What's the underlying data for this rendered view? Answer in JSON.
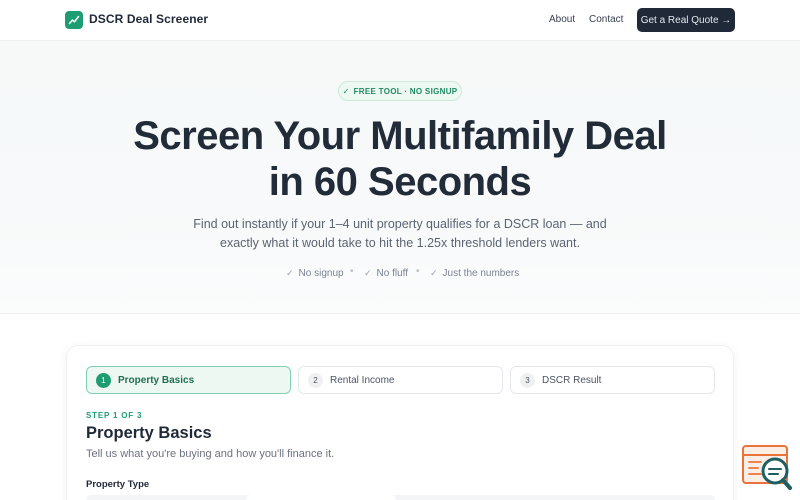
{
  "header": {
    "brand": "DSCR Deal Screener",
    "nav": {
      "about": "About",
      "contact": "Contact"
    },
    "cta": "Get a Real Quote →",
    "logo_icon": "trend-chart-icon"
  },
  "hero": {
    "badge": "FREE TOOL · NO SIGNUP",
    "title_line1": "Screen Your Multifamily Deal",
    "title_line2": "in 60 Seconds",
    "subtitle_line1": "Find out instantly if your 1–4 unit property qualifies for a DSCR loan — and",
    "subtitle_line2": "exactly what it would take to hit the 1.25x threshold lenders want.",
    "bullets": [
      "No signup",
      "No fluff",
      "Just the numbers"
    ],
    "separator": "•",
    "check": "✓"
  },
  "wizard": {
    "steps": [
      {
        "num": "1",
        "label": "Property Basics",
        "active": true
      },
      {
        "num": "2",
        "label": "Rental Income",
        "active": false
      },
      {
        "num": "3",
        "label": "DSCR Result",
        "active": false
      }
    ],
    "step_of": "STEP 1 OF 3",
    "title": "Property Basics",
    "subtitle": "Tell us what you're buying and how you'll finance it.",
    "field_label": "Property Type"
  },
  "colors": {
    "accent": "#1f9d72",
    "dark": "#1f2937",
    "widget_orange": "#e8743b",
    "widget_teal": "#1e5f63"
  }
}
